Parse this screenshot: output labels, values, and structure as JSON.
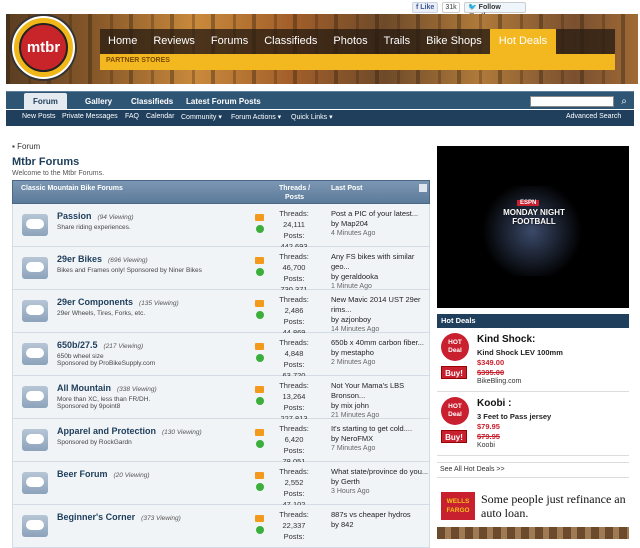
{
  "social": {
    "like_label": "Like",
    "like_count": "31k",
    "follow_label": "Follow @mtbr"
  },
  "logo": {
    "text": "mtbr"
  },
  "main_nav": [
    "Home",
    "Reviews",
    "Forums",
    "Classifieds",
    "Photos",
    "Trails",
    "Bike Shops",
    "Hot Deals"
  ],
  "partner_stores": "PARTNER STORES",
  "sub_nav": {
    "tabs": [
      "Forum",
      "Gallery",
      "Classifieds",
      "Latest Forum Posts"
    ]
  },
  "toolbar": {
    "links": [
      "New Posts",
      "Private Messages",
      "FAQ",
      "Calendar",
      "Community ▾",
      "Forum Actions ▾",
      "Quick Links ▾"
    ],
    "advanced_search": "Advanced Search"
  },
  "breadcrumb": "Forum",
  "page_title": "Mtbr Forums",
  "welcome": "Welcome to the Mtbr Forums.",
  "forum_table": {
    "header_title": "Classic Mountain Bike Forums",
    "header_threads": "Threads /",
    "header_posts": "Posts",
    "header_last": "Last Post"
  },
  "forums": [
    {
      "title": "Passion",
      "viewing": "(94 Viewing)",
      "desc": "Share riding experiences.",
      "threads": "24,111",
      "posts": "442,693",
      "last_title": "Post a PIC of your latest...",
      "last_by": "by Map204",
      "last_time": "4 Minutes Ago"
    },
    {
      "title": "29er Bikes",
      "viewing": "(696 Viewing)",
      "desc": "Bikes and Frames only! Sponsored by Niner Bikes",
      "threads": "46,700",
      "posts": "730,371",
      "last_title": "Any FS bikes with similar geo...",
      "last_by": "by geraldooka",
      "last_time": "1 Minute Ago"
    },
    {
      "title": "29er Components",
      "viewing": "(135 Viewing)",
      "desc": "29er Wheels, Tires, Forks, etc.",
      "threads": "2,486",
      "posts": "44,869",
      "last_title": "New Mavic 2014 UST 29er rims...",
      "last_by": "by azjonboy",
      "last_time": "14 Minutes Ago"
    },
    {
      "title": "650b/27.5",
      "viewing": "(217 Viewing)",
      "desc": "650b wheel size\nSponsored by ProBikeSupply.com",
      "threads": "4,848",
      "posts": "63,720",
      "last_title": "650b x 40mm carbon fiber...",
      "last_by": "by mestapho",
      "last_time": "2 Minutes Ago"
    },
    {
      "title": "All Mountain",
      "viewing": "(338 Viewing)",
      "desc": "More than XC, less than FR/DH.\nSponsored by 9point8",
      "threads": "13,264",
      "posts": "227,813",
      "last_title": "Not Your Mama's LBS Bronson...",
      "last_by": "by mix john",
      "last_time": "21 Minutes Ago"
    },
    {
      "title": "Apparel and Protection",
      "viewing": "(130 Viewing)",
      "desc": "Sponsored by RockGardn",
      "threads": "6,420",
      "posts": "78,051",
      "last_title": "It's starting to get cold....",
      "last_by": "by NeroFMX",
      "last_time": "7 Minutes Ago"
    },
    {
      "title": "Beer Forum",
      "viewing": "(20 Viewing)",
      "desc": "",
      "threads": "2,552",
      "posts": "47,102",
      "last_title": "What state/province do you...",
      "last_by": "by Gerth",
      "last_time": "3 Hours Ago"
    },
    {
      "title": "Beginner's Corner",
      "viewing": "(373 Viewing)",
      "desc": "",
      "threads": "22,337",
      "posts": "",
      "last_title": "887s vs cheaper hydros",
      "last_by": "by 842",
      "last_time": ""
    }
  ],
  "stat_labels": {
    "threads": "Threads:",
    "posts": "Posts:"
  },
  "ad_nfl": {
    "network": "ESPN",
    "title": "MONDAY NIGHT FOOTBALL"
  },
  "hot_deals": {
    "header": "Hot Deals",
    "badge": "HOT Deal",
    "buy": "Buy!",
    "items": [
      {
        "name": "Kind Shock:",
        "sub": "Kind Shock LEV 100mm",
        "price": "$349.00",
        "old": "$395.00",
        "site": "BikeBling.com"
      },
      {
        "name": "Koobi :",
        "sub": "3 Feet to Pass jersey",
        "price": "$79.95",
        "old": "$79.95",
        "site": "Koobi"
      }
    ],
    "see_all": "See All Hot Deals >>"
  },
  "ad_wf": {
    "brand": "WELLS FARGO",
    "text": "Some people just refinance an auto loan."
  },
  "colors": {
    "nav_dark": "#1f3f5c",
    "hot": "#f3b820",
    "brand_red": "#c8202f"
  }
}
